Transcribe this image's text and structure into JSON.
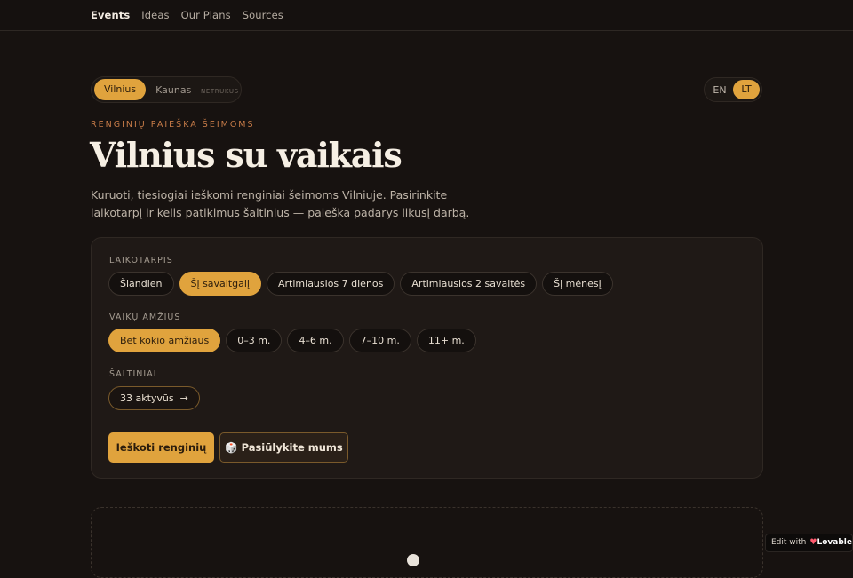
{
  "nav": {
    "items": [
      "Events",
      "Ideas",
      "Our Plans",
      "Sources"
    ],
    "active": "Events"
  },
  "city_toggle": {
    "active": "Vilnius",
    "inactive": "Kaunas",
    "inactive_badge": "· NETRUKUS"
  },
  "language": {
    "options": [
      "EN",
      "LT"
    ],
    "active": "LT"
  },
  "hero": {
    "eyebrow": "RENGINIŲ PAIEŠKA ŠEIMOMS",
    "title": "Vilnius su vaikais",
    "description": "Kuruoti, tiesiogiai ieškomi renginiai šeimoms Vilniuje. Pasirinkite laikotarpį ir kelis patikimus šaltinius — paieška padarys likusį darbą."
  },
  "filters": {
    "period": {
      "label": "LAIKOTARPIS",
      "options": [
        "Šiandien",
        "Šį savaitgalį",
        "Artimiausios 7 dienos",
        "Artimiausios 2 savaitės",
        "Šį mėnesį"
      ],
      "selected": "Šį savaitgalį"
    },
    "age": {
      "label": "VAIKŲ AMŽIUS",
      "options": [
        "Bet kokio amžiaus",
        "0–3 m.",
        "4–6 m.",
        "7–10 m.",
        "11+ m."
      ],
      "selected": "Bet kokio amžiaus"
    },
    "sources": {
      "label": "ŠALTINIAI",
      "button": "33 aktyvūs",
      "arrow": "→"
    }
  },
  "actions": {
    "search": "Ieškoti renginių",
    "suggest_icon": "🎲",
    "suggest": "Pasiūlykite mums"
  },
  "badge": {
    "prefix": "Edit with",
    "brand": "Lovable"
  },
  "colors": {
    "background": "#171210",
    "accent": "#e0a33d",
    "eyebrow": "#c67b48",
    "panel": "#1f1916"
  }
}
